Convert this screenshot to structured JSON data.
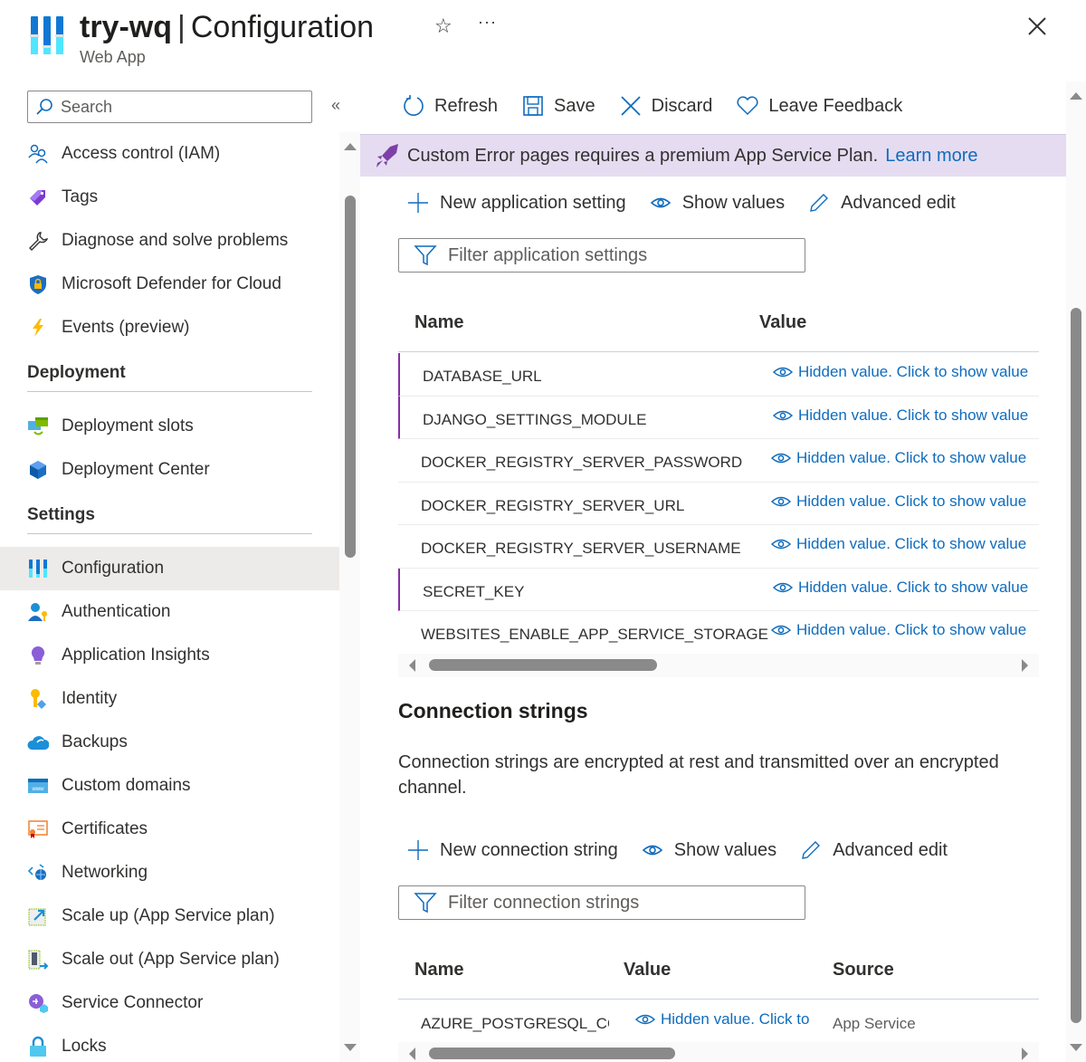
{
  "header": {
    "resource_name": "try-wq",
    "separator": "|",
    "page_name": "Configuration",
    "subtitle": "Web App",
    "favorite_icon": "star-icon",
    "more_icon": "ellipsis-icon",
    "more_label": "···",
    "close_icon": "close-icon"
  },
  "sidebar": {
    "search_placeholder": "Search",
    "collapse_label": "«",
    "items_top": [
      {
        "label": "Access control (IAM)",
        "icon": "people-icon"
      },
      {
        "label": "Tags",
        "icon": "tag-icon"
      },
      {
        "label": "Diagnose and solve problems",
        "icon": "wrench-icon"
      },
      {
        "label": "Microsoft Defender for Cloud",
        "icon": "shield-lock-icon"
      },
      {
        "label": "Events (preview)",
        "icon": "lightning-icon"
      }
    ],
    "deployment_section": "Deployment",
    "deployment_items": [
      {
        "label": "Deployment slots",
        "icon": "deployment-slots-icon"
      },
      {
        "label": "Deployment Center",
        "icon": "cube-icon"
      }
    ],
    "settings_section": "Settings",
    "settings_items": [
      {
        "label": "Configuration",
        "icon": "configuration-icon",
        "active": true
      },
      {
        "label": "Authentication",
        "icon": "user-key-icon"
      },
      {
        "label": "Application Insights",
        "icon": "lightbulb-icon"
      },
      {
        "label": "Identity",
        "icon": "key-icon"
      },
      {
        "label": "Backups",
        "icon": "cloud-backup-icon"
      },
      {
        "label": "Custom domains",
        "icon": "www-icon"
      },
      {
        "label": "Certificates",
        "icon": "certificate-icon"
      },
      {
        "label": "Networking",
        "icon": "network-icon"
      },
      {
        "label": "Scale up (App Service plan)",
        "icon": "scale-up-icon"
      },
      {
        "label": "Scale out (App Service plan)",
        "icon": "scale-out-icon"
      },
      {
        "label": "Service Connector",
        "icon": "plug-icon"
      },
      {
        "label": "Locks",
        "icon": "lock-icon"
      }
    ]
  },
  "toolbar": {
    "refresh": "Refresh",
    "save": "Save",
    "discard": "Discard",
    "feedback": "Leave Feedback"
  },
  "banner": {
    "text": "Custom Error pages requires a premium App Service Plan.",
    "link": "Learn more",
    "icon": "rocket-icon"
  },
  "app_settings": {
    "new_label": "New application setting",
    "show_values_label": "Show values",
    "advanced_edit_label": "Advanced edit",
    "filter_placeholder": "Filter application settings",
    "columns": {
      "name": "Name",
      "value": "Value"
    },
    "rows": [
      {
        "name": "DATABASE_URL",
        "value": "Hidden value. Click to show value",
        "modified": true
      },
      {
        "name": "DJANGO_SETTINGS_MODULE",
        "value": "Hidden value. Click to show value",
        "modified": true
      },
      {
        "name": "DOCKER_REGISTRY_SERVER_PASSWORD",
        "value": "Hidden value. Click to show value",
        "modified": false
      },
      {
        "name": "DOCKER_REGISTRY_SERVER_URL",
        "value": "Hidden value. Click to show value",
        "modified": false
      },
      {
        "name": "DOCKER_REGISTRY_SERVER_USERNAME",
        "value": "Hidden value. Click to show value",
        "modified": false
      },
      {
        "name": "SECRET_KEY",
        "value": "Hidden value. Click to show value",
        "modified": true
      },
      {
        "name": "WEBSITES_ENABLE_APP_SERVICE_STORAGE",
        "value": "Hidden value. Click to show value",
        "modified": false
      }
    ]
  },
  "connection_strings": {
    "title": "Connection strings",
    "description": "Connection strings are encrypted at rest and transmitted over an encrypted channel.",
    "new_label": "New connection string",
    "show_values_label": "Show values",
    "advanced_edit_label": "Advanced edit",
    "filter_placeholder": "Filter connection strings",
    "columns": {
      "name": "Name",
      "value": "Value",
      "source": "Source"
    },
    "rows": [
      {
        "name": "AZURE_POSTGRESQL_CON",
        "value": "Hidden value. Click to",
        "source": "App Service"
      }
    ]
  },
  "colors": {
    "accent": "#0f6cbd",
    "banner_bg": "#e5dcf1",
    "modified_marker": "#8a2da5",
    "active_nav_bg": "#edebe9"
  }
}
